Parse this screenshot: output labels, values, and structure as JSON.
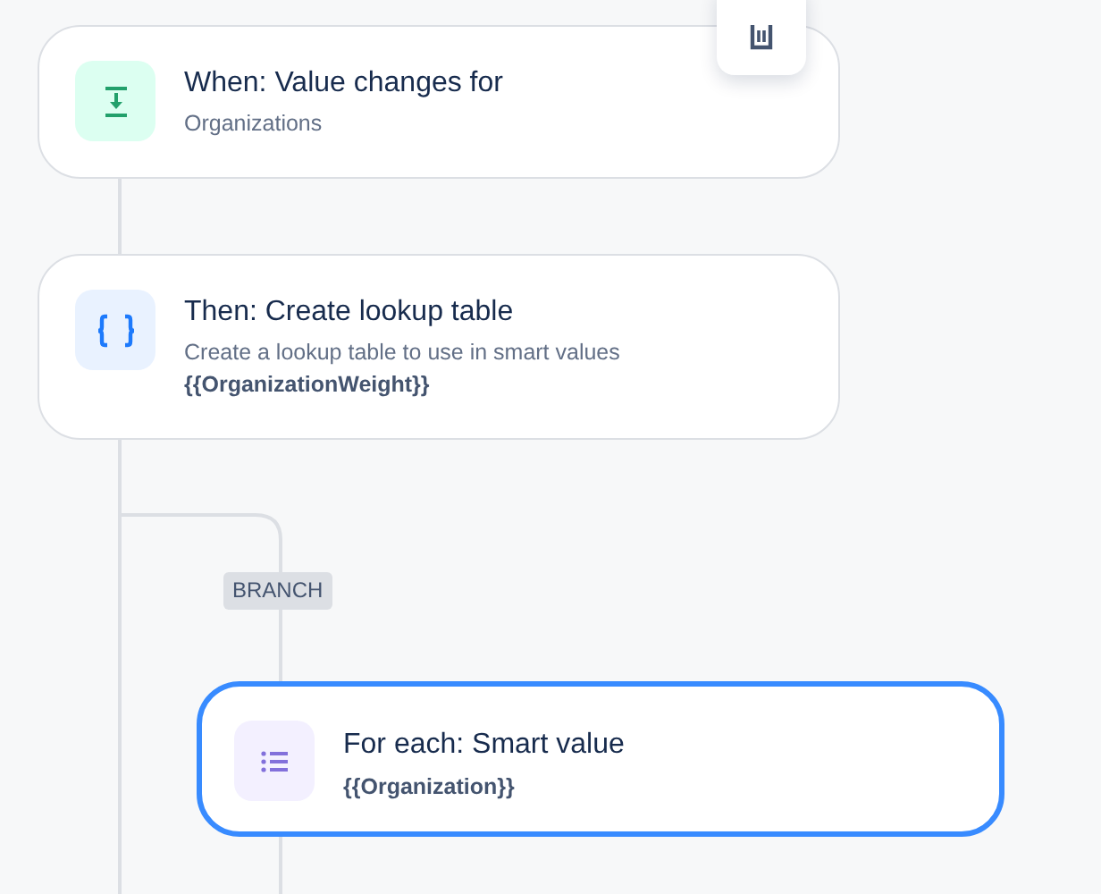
{
  "steps": [
    {
      "kind": "trigger",
      "title": "When: Value changes for",
      "description": "Organizations",
      "selected": false
    },
    {
      "kind": "action",
      "title": "Then: Create lookup table",
      "description": "Create a lookup table to use in smart values",
      "smart_value": "{{OrganizationWeight}}",
      "selected": false
    },
    {
      "kind": "loop",
      "title": "For each: Smart value",
      "smart_value": "{{Organization}}",
      "selected": true
    }
  ],
  "branch_label": "BRANCH"
}
